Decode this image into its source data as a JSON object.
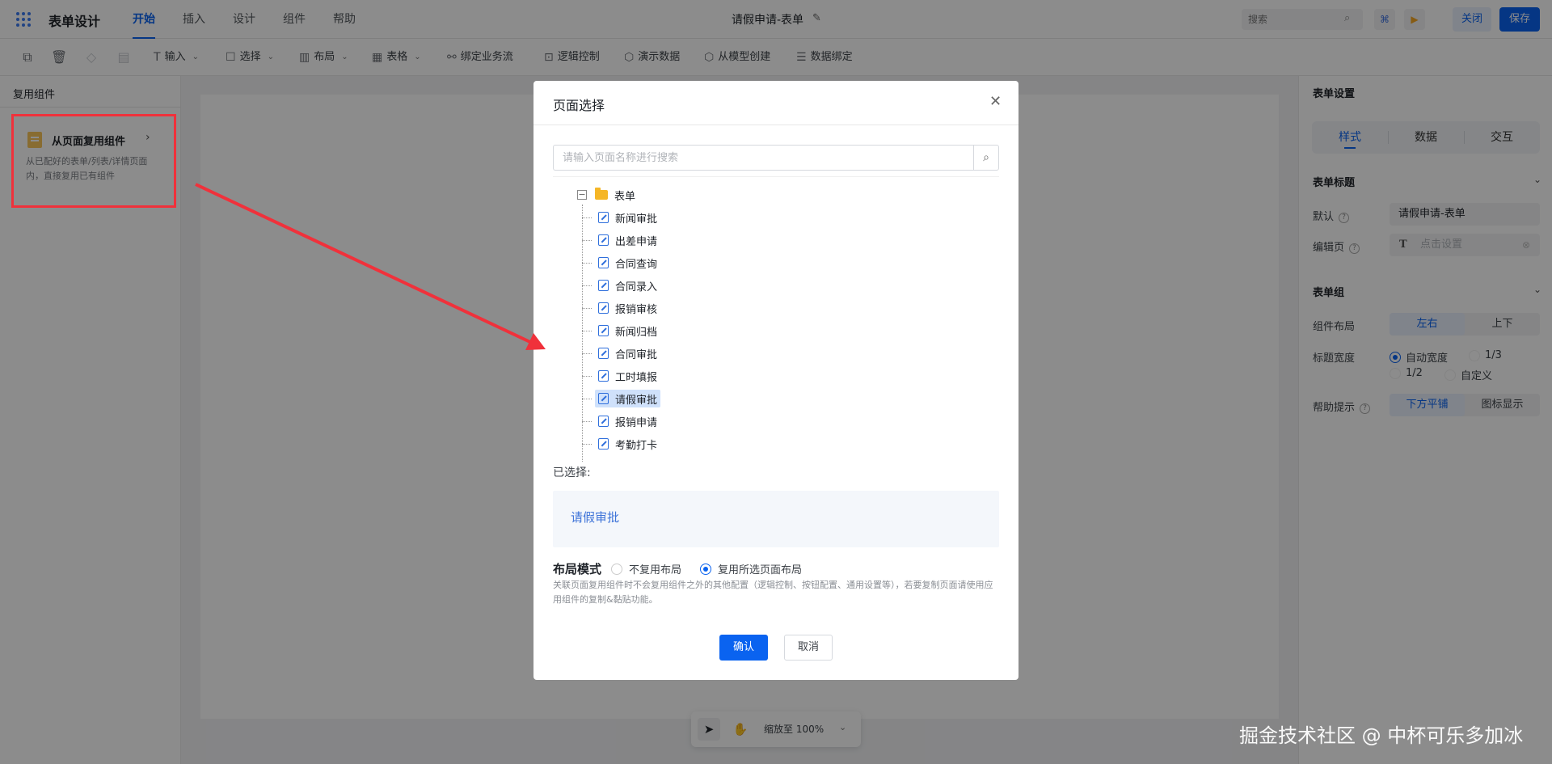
{
  "app": {
    "title": "表单设计",
    "tabs": [
      "开始",
      "插入",
      "设计",
      "组件",
      "帮助"
    ],
    "active_tab": "开始",
    "doc_title": "请假申请-表单",
    "search_placeholder": "搜索",
    "close_label": "关闭",
    "save_label": "保存"
  },
  "toolbar": {
    "items": [
      "输入",
      "选择",
      "布局",
      "表格",
      "绑定业务流",
      "逻辑控制",
      "演示数据",
      "从模型创建",
      "数据绑定"
    ]
  },
  "left_panel": {
    "title": "复用组件",
    "card_title": "从页面复用组件",
    "card_desc": "从已配好的表单/列表/详情页面内，直接复用已有组件"
  },
  "right_panel": {
    "title": "表单设置",
    "tabs": [
      "样式",
      "数据",
      "交互"
    ],
    "active_tab": "样式",
    "section_title": "表单标题",
    "default_label": "默认",
    "default_value": "请假申请-表单",
    "edit_label": "编辑页",
    "edit_placeholder": "点击设置",
    "section_group": "表单组",
    "layout_label": "组件布局",
    "layout_options": [
      "左右",
      "上下"
    ],
    "layout_selected": "左右",
    "width_label": "标题宽度",
    "width_options": [
      "自动宽度",
      "1/3",
      "1/2",
      "自定义"
    ],
    "width_selected": "自动宽度",
    "help_label": "帮助提示",
    "help_options": [
      "下方平铺",
      "图标显示"
    ],
    "help_selected": "下方平铺"
  },
  "zoom": {
    "label": "缩放至 100%"
  },
  "modal": {
    "title": "页面选择",
    "search_placeholder": "请输入页面名称进行搜索",
    "tree_root": "表单",
    "tree_items": [
      "新闻审批",
      "出差申请",
      "合同查询",
      "合同录入",
      "报销审核",
      "新闻归档",
      "合同审批",
      "工时填报",
      "请假审批",
      "报销申请",
      "考勤打卡"
    ],
    "selected_item": "请假审批",
    "selected_label": "已选择:",
    "selected_value": "请假审批",
    "layout_mode_label": "布局模式",
    "layout_mode_options": [
      "不复用布局",
      "复用所选页面布局"
    ],
    "layout_mode_selected": "复用所选页面布局",
    "layout_note": "关联页面复用组件时不会复用组件之外的其他配置（逻辑控制、按钮配置、通用设置等），若要复制页面请使用应用组件的复制&黏贴功能。",
    "confirm_label": "确认",
    "cancel_label": "取消"
  },
  "watermark": "掘金技术社区 @ 中杯可乐多加冰",
  "colors": {
    "accent": "#0a63f0",
    "highlight_red": "#f0313b",
    "selection": "#cfe1fb"
  }
}
